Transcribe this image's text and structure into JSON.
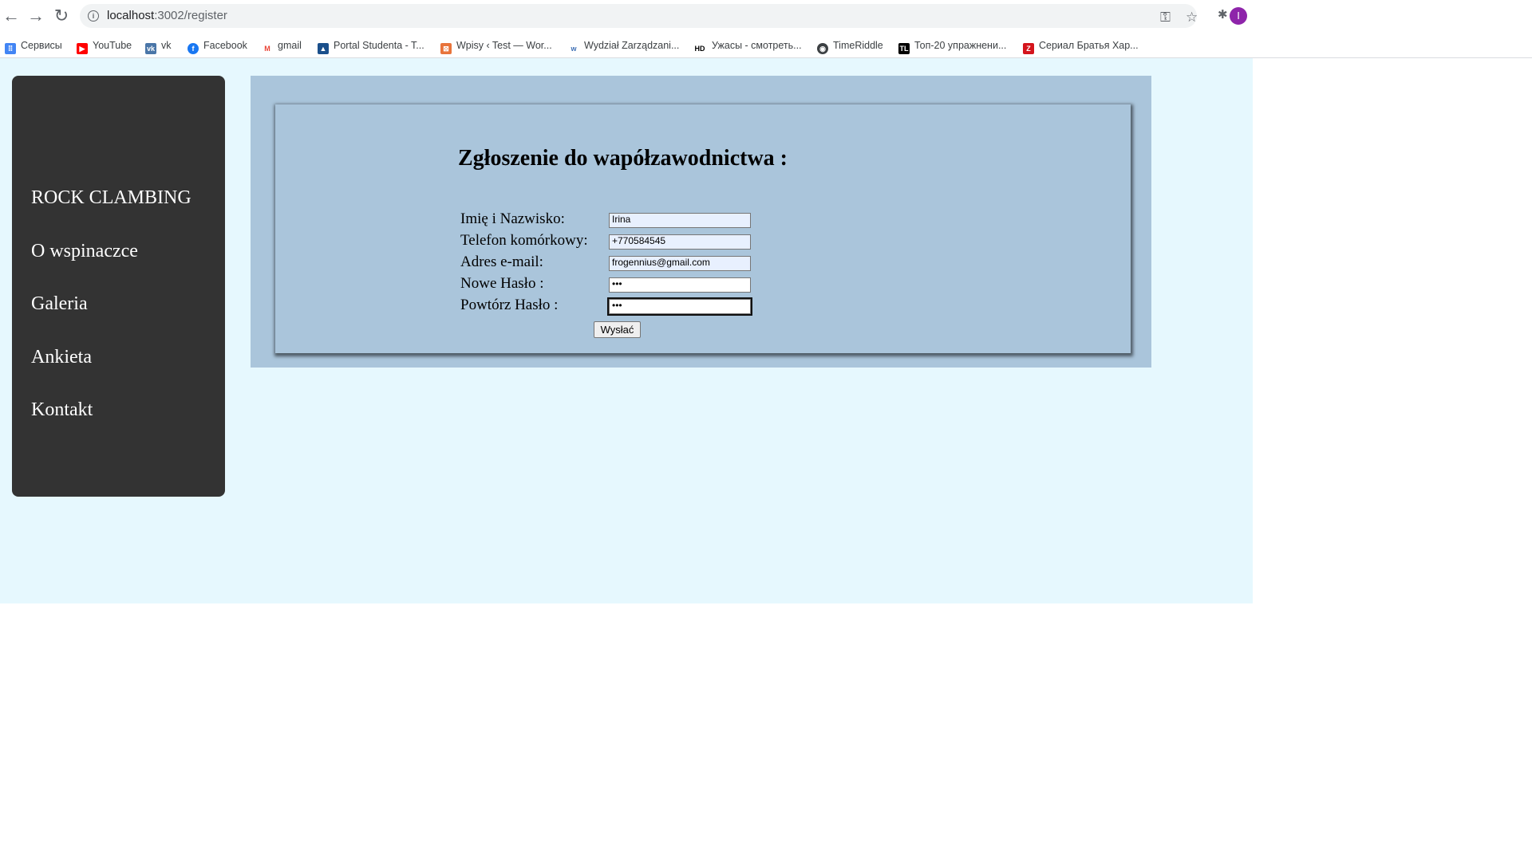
{
  "browser": {
    "url_host": "localhost",
    "url_path": ":3002/register",
    "avatar_letter": "I"
  },
  "bookmarks": [
    {
      "label": "Сервисы",
      "icon": "apps-grid-icon",
      "color": "#4285f4"
    },
    {
      "label": "YouTube",
      "icon": "youtube-icon",
      "color": "#ff0000"
    },
    {
      "label": "vk",
      "icon": "vk-icon",
      "color": "#4a76a8"
    },
    {
      "label": "Facebook",
      "icon": "facebook-icon",
      "color": "#1877f2"
    },
    {
      "label": "gmail",
      "icon": "gmail-icon",
      "color": "#ea4335"
    },
    {
      "label": "Portal Studenta - T...",
      "icon": "portal-icon",
      "color": "#1a4f8b"
    },
    {
      "label": "Wpisy ‹ Test — Wor...",
      "icon": "wordpress-icon",
      "color": "#e8743b"
    },
    {
      "label": "Wydział Zarządzani...",
      "icon": "university-icon",
      "color": "#3c6eb4"
    },
    {
      "label": "Ужасы - смотреть...",
      "icon": "hd-icon",
      "color": "#000000"
    },
    {
      "label": "TimeRiddle",
      "icon": "globe-icon",
      "color": "#3c4043"
    },
    {
      "label": "Топ-20 упражнени...",
      "icon": "tl-icon",
      "color": "#000000"
    },
    {
      "label": "Сериал Братья Хар...",
      "icon": "z-icon",
      "color": "#d4141c"
    }
  ],
  "sidebar": {
    "items": [
      {
        "label": "ROCK CLAMBING"
      },
      {
        "label": "O wspinaczce"
      },
      {
        "label": "Galeria"
      },
      {
        "label": "Ankieta"
      },
      {
        "label": "Kontakt"
      }
    ]
  },
  "form": {
    "title": "Zgłoszenie do wapółzawodnictwa :",
    "fields": [
      {
        "label": "Imię i Nazwisko:",
        "value": "Irina"
      },
      {
        "label": "Telefon komórkowy:",
        "value": "+770584545"
      },
      {
        "label": "Adres e-mail:",
        "value": "frogennius@gmail.com"
      },
      {
        "label": "Nowe Hasło :",
        "value": "•••"
      },
      {
        "label": "Powtórz Hasło :",
        "value": "•••"
      }
    ],
    "submit_label": "Wysłać"
  },
  "colors": {
    "page_background": "#e6f8fe",
    "sidebar_background": "#333333",
    "panel_background": "#aac5db"
  }
}
